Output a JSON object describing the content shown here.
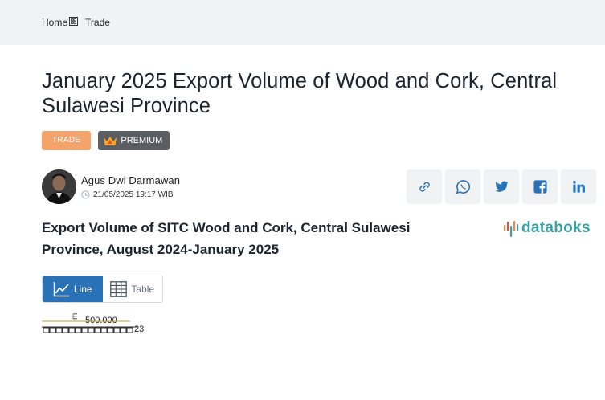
{
  "breadcrumb": {
    "home": "Home",
    "current": "Trade"
  },
  "article": {
    "title": "January 2025 Export Volume of Wood and Cork, Central Sulawesi Province",
    "tag": "TRADE",
    "premium_label": "PREMIUM"
  },
  "author": {
    "name": "Agus Dwi Darmawan",
    "date": "21/05/2025 19:17 WIB"
  },
  "share": {
    "icons": [
      "link-icon",
      "whatsapp-icon",
      "twitter-icon",
      "facebook-icon",
      "linkedin-icon"
    ]
  },
  "chart": {
    "heading": "Export Volume of SITC Wood and Cork, Central Sulawesi Province, August 2024-January 2025",
    "brand": "databoks",
    "view_toggle": {
      "line": "Line",
      "table": "Table"
    }
  },
  "chart_data": {
    "type": "line",
    "ylabel": "m",
    "y_tick_labels": [
      "500.000"
    ],
    "x_label_fragment": "23"
  },
  "colors": {
    "accent": "#2a72b8",
    "tag": "#f4a46b",
    "premium": "#5a5e63",
    "brand": "#3aa0a5",
    "topbar": "#f1f2f4"
  }
}
